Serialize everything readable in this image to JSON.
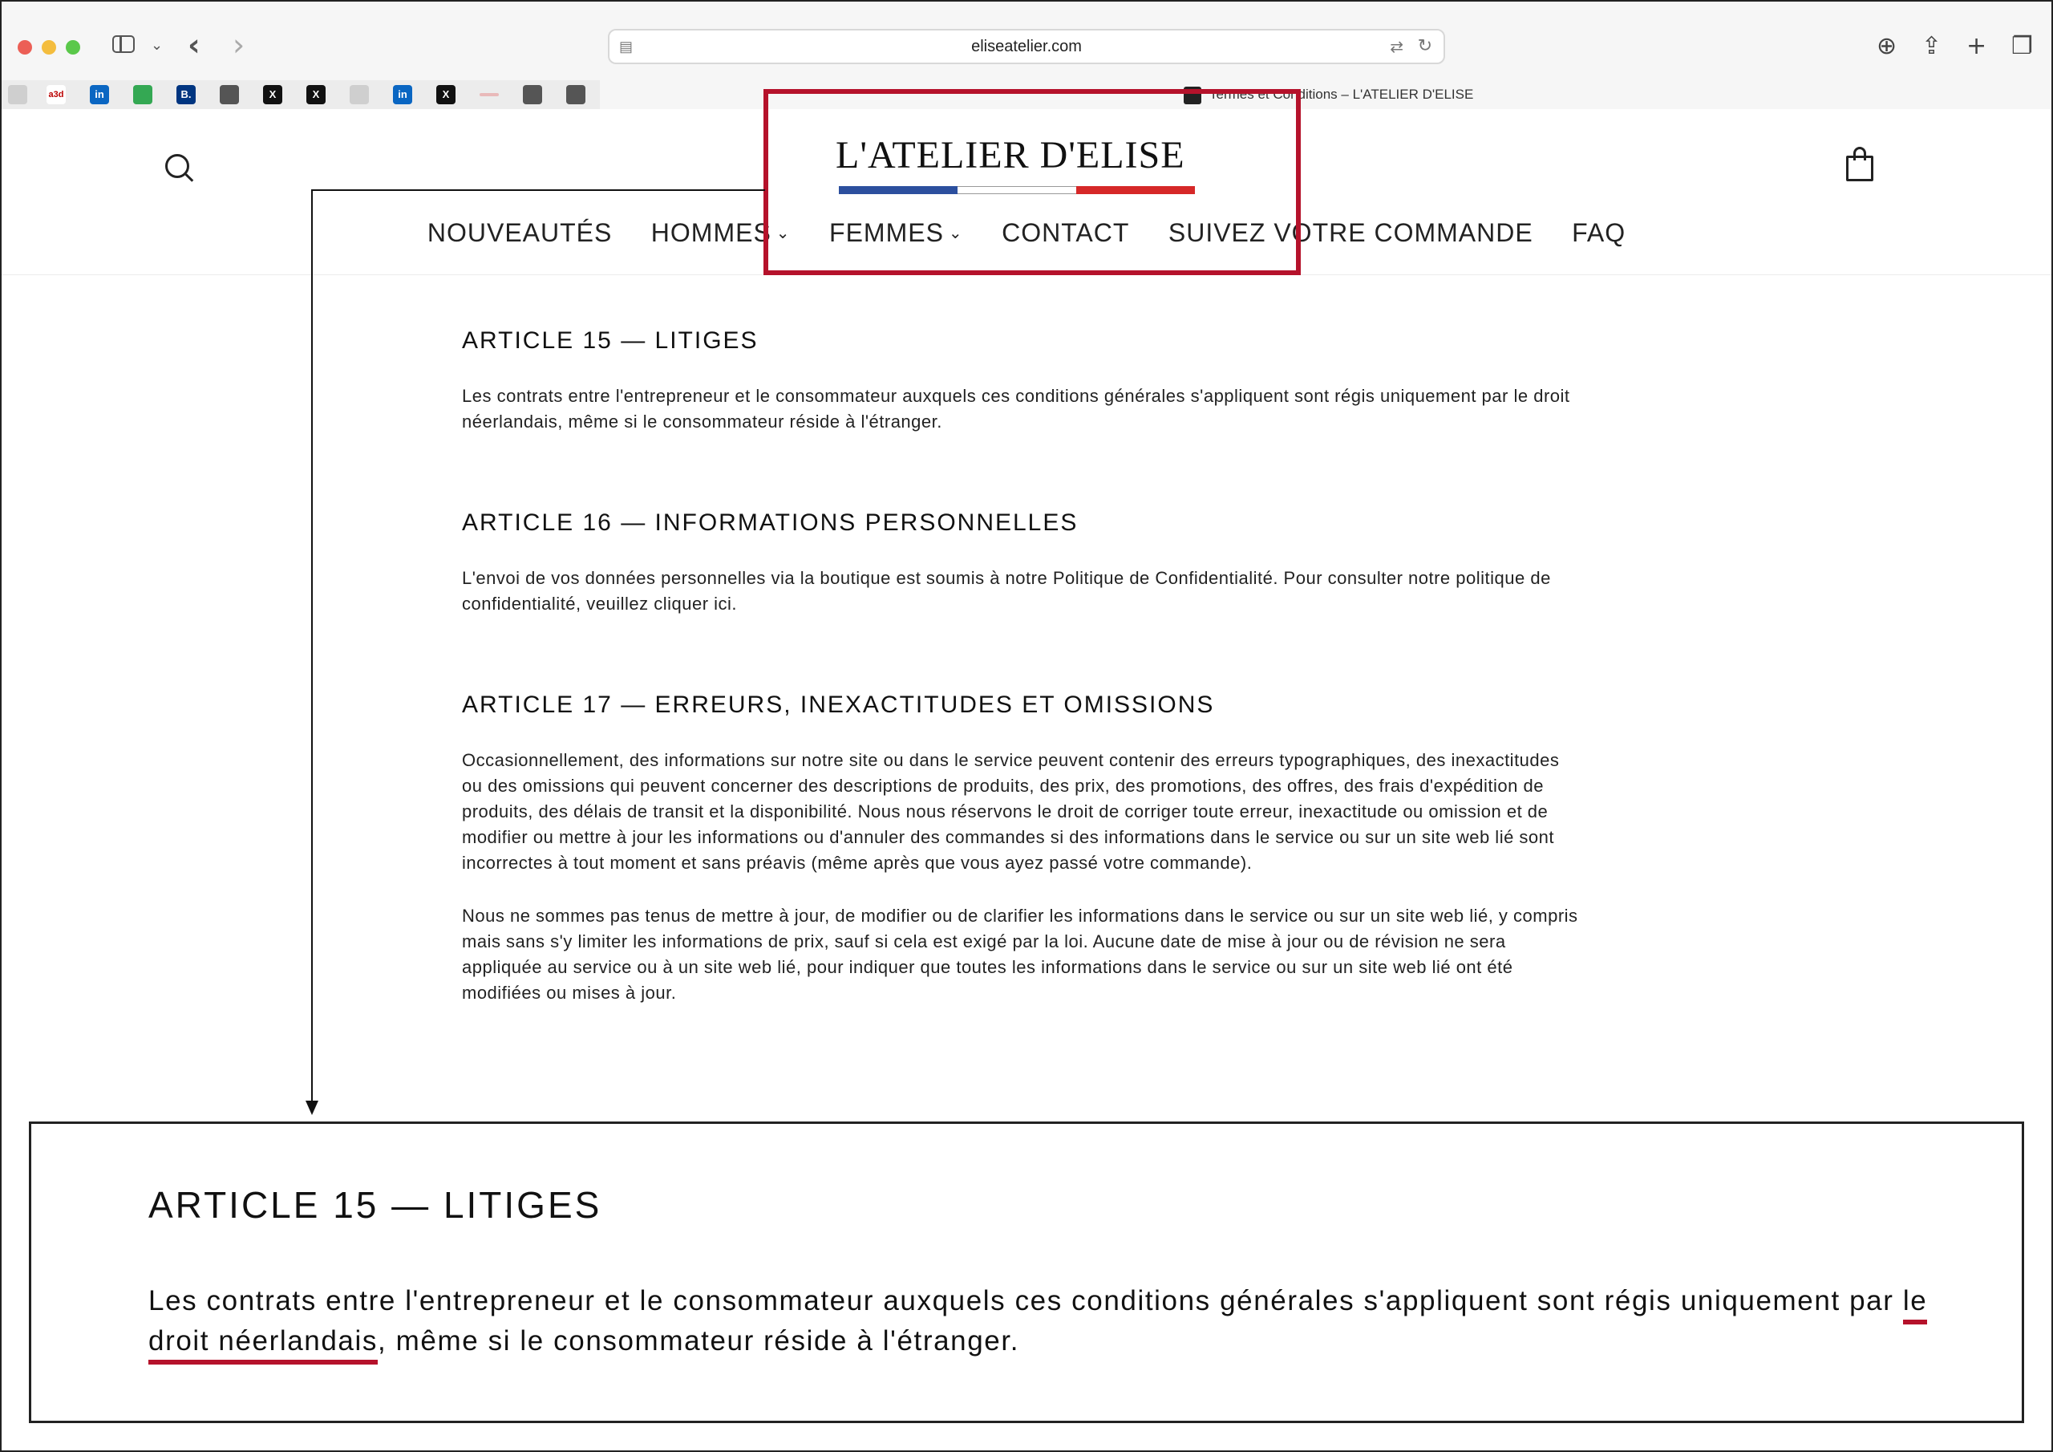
{
  "browser": {
    "url": "eliseatelier.com",
    "tab_title": "Termes et Conditions – L'ATELIER D'ELISE",
    "bookmarks": [
      "bird",
      "a3d",
      "in",
      "maps",
      "B.",
      "person",
      "X",
      "X",
      "bird",
      "in",
      "X",
      "line",
      "person",
      "person"
    ]
  },
  "site": {
    "logo": "L'ATELIER D'ELISE",
    "flag_colors": [
      "#2c4f9e",
      "#ffffff",
      "#d62828"
    ],
    "nav": [
      {
        "label": "NOUVEAUTÉS"
      },
      {
        "label": "HOMMES"
      },
      {
        "label": "FEMMES"
      },
      {
        "label": "CONTACT"
      },
      {
        "label": "SUIVEZ VOTRE COMMANDE"
      },
      {
        "label": "FAQ"
      }
    ]
  },
  "articles": {
    "a15": {
      "title": "ARTICLE 15 — LITIGES",
      "p1": "Les contrats entre l'entrepreneur et le consommateur auxquels ces conditions générales s'appliquent sont régis uniquement par le droit néerlandais, même si le consommateur réside à l'étranger."
    },
    "a16": {
      "title": "ARTICLE 16 — INFORMATIONS PERSONNELLES",
      "p1": "L'envoi de vos données personnelles via la boutique est soumis à notre Politique de Confidentialité. Pour consulter notre politique de confidentialité, veuillez cliquer ici."
    },
    "a17": {
      "title": "ARTICLE 17 — ERREURS, INEXACTITUDES ET OMISSIONS",
      "p1": "Occasionnellement, des informations sur notre site ou dans le service peuvent contenir des erreurs typographiques, des inexactitudes ou des omissions qui peuvent concerner des descriptions de produits, des prix, des promotions, des offres, des frais d'expédition de produits, des délais de transit et la disponibilité. Nous nous réservons le droit de corriger toute erreur, inexactitude ou omission et de modifier ou mettre à jour les informations ou d'annuler des commandes si des informations dans le service ou sur un site web lié sont incorrectes à tout moment et sans préavis (même après que vous ayez passé votre commande).",
      "p2": "Nous ne sommes pas tenus de mettre à jour, de modifier ou de clarifier les informations dans le service ou sur un site web lié, y compris mais sans s'y limiter les informations de prix, sauf si cela est exigé par la loi. Aucune date de mise à jour ou de révision ne sera appliquée au service ou à un site web lié, pour indiquer que toutes les informations dans le service ou sur un site web lié ont été modifiées ou mises à jour."
    }
  },
  "zoom": {
    "title": "ARTICLE 15 — LITIGES",
    "text_before": "Les contrats entre l'entrepreneur et le consommateur auxquels ces conditions générales s'appliquent sont régis uniquement par ",
    "highlight": "le droit néerlandais",
    "text_after": ", même si le consommateur réside à l'étranger."
  },
  "annotation_color": "#b5122b"
}
